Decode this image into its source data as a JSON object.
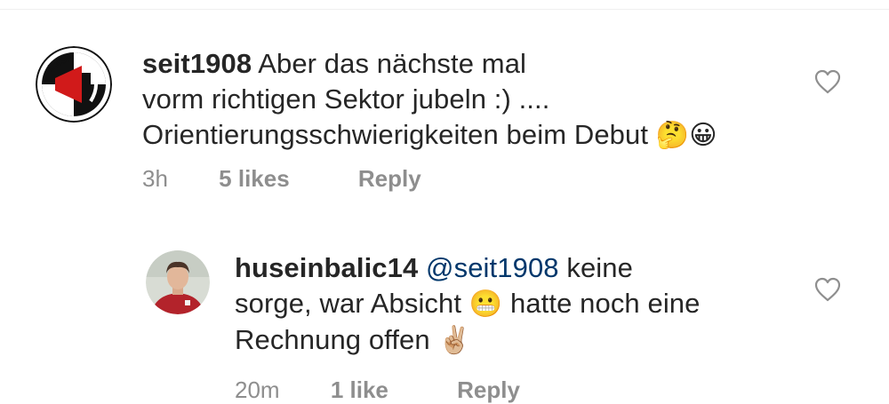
{
  "comments": [
    {
      "username": "seit1908",
      "mention": "",
      "lines": [
        "Aber das nächste mal",
        "vorm richtigen Sektor jubeln :) ....",
        "Orientierungsschwierigkeiten beim Debut"
      ],
      "line3_emojis": "🤔😀",
      "avatar_icon": "lask-logo",
      "time": "3h",
      "likes": "5 likes",
      "reply_label": "Reply"
    },
    {
      "username": "huseinbalic14",
      "mention": "@seit1908",
      "line1_rest": " keine",
      "line2_a": "sorge, war Absicht ",
      "line2_emoji": "😬",
      "line2_b": " hatte noch eine",
      "line3": "Rechnung offen ",
      "line3_emoji": "✌🏼",
      "avatar_icon": "profile-photo",
      "time": "20m",
      "likes": "1 like",
      "reply_label": "Reply"
    }
  ],
  "colors": {
    "text": "#262626",
    "meta": "#8e8e8e",
    "mention": "#00376b",
    "heart": "#8e8e8e"
  }
}
